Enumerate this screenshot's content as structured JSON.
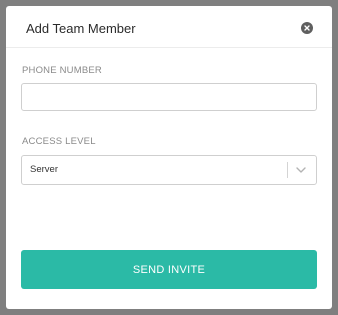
{
  "modal": {
    "title": "Add Team Member",
    "close_icon": "close-circle-icon"
  },
  "form": {
    "phone": {
      "label": "PHONE NUMBER",
      "value": "",
      "placeholder": ""
    },
    "access": {
      "label": "ACCESS LEVEL",
      "selected": "Server",
      "chevron_icon": "chevron-down-icon"
    },
    "submit_label": "SEND INVITE"
  },
  "colors": {
    "accent": "#2bbaa6",
    "backdrop": "#7f7f7f"
  }
}
